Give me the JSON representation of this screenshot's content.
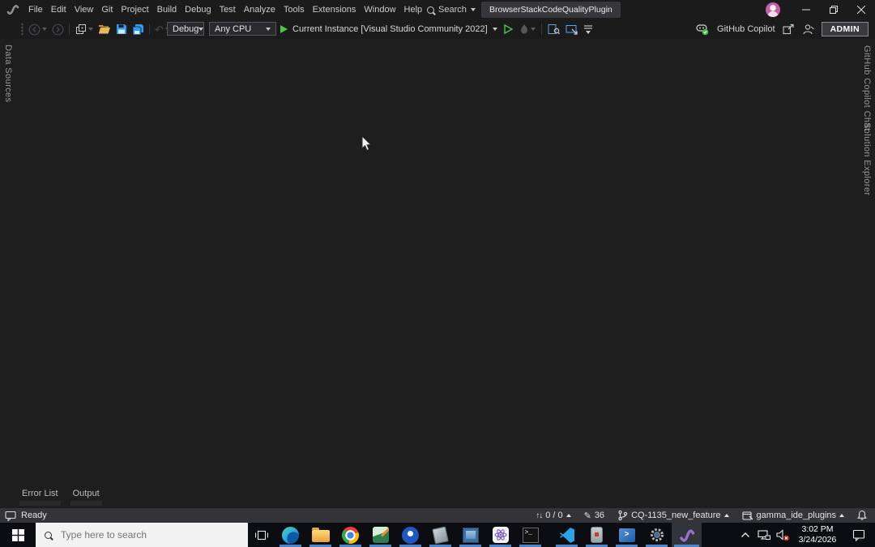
{
  "title_bar": {
    "menu_items": [
      "File",
      "Edit",
      "View",
      "Git",
      "Project",
      "Build",
      "Debug",
      "Test",
      "Analyze",
      "Tools",
      "Extensions",
      "Window",
      "Help"
    ],
    "search_label": "Search",
    "solution_name": "BrowserStackCodeQualityPlugin"
  },
  "toolbar": {
    "configuration": "Debug",
    "platform": "Any CPU",
    "run_target": "Current Instance [Visual Studio Community 2022]",
    "copilot_label": "GitHub Copilot",
    "account_label": "ADMIN"
  },
  "side_tabs": {
    "left_tab": "Data Sources",
    "right_tab_1": "GitHub Copilot Chat",
    "right_tab_2": "Solution Explorer"
  },
  "bottom_panel": {
    "tab_1": "Error List",
    "tab_2": "Output"
  },
  "status_bar": {
    "message": "Ready",
    "sync_count": "0 / 0",
    "pending_edits": "36",
    "branch_name": "CQ-1135_new_feature",
    "repo_name": "gamma_ide_plugins"
  },
  "taskbar": {
    "search_placeholder": "Type here to search",
    "clock_time": "3:02 PM",
    "clock_date": "3/24/2026"
  },
  "glyphs": {
    "undo": "↶",
    "redo": "↷",
    "sync": "↑↓",
    "pencil": "✎",
    "terminal": ">_",
    "powershell": ">"
  },
  "icon_names": [
    "vs-logo-icon",
    "search-icon",
    "minimize-icon",
    "restore-icon",
    "close-icon",
    "back-icon",
    "forward-icon",
    "new-project-icon",
    "open-folder-icon",
    "save-icon",
    "save-all-icon",
    "undo-icon",
    "redo-icon",
    "run-icon",
    "start-without-debug-icon",
    "hot-reload-icon",
    "find-in-files-icon",
    "attach-icon",
    "toolbar-overflow-icon",
    "github-copilot-icon",
    "share-icon",
    "feedback-icon",
    "feedback-bubble-icon",
    "sync-icon",
    "pencil-icon",
    "branch-icon",
    "repo-icon",
    "bell-icon",
    "windows-start-icon",
    "task-view-icon",
    "edge-icon",
    "file-explorer-icon",
    "chrome-icon",
    "image-editor-icon",
    "maps-icon",
    "notepad-icon",
    "media-player-icon",
    "atom-app-icon",
    "command-prompt-icon",
    "vscode-icon",
    "mobile-device-icon",
    "powershell-icon",
    "settings-gear-icon",
    "visual-studio-icon",
    "tray-chevron-icon",
    "network-icon",
    "volume-muted-icon",
    "action-center-icon",
    "mouse-cursor"
  ],
  "colors": {
    "titlebar_bg": "#1b1b1c",
    "canvas_bg": "#1e1e1f",
    "statusbar_bg": "#343438",
    "taskbar_bg": "#0c0d10",
    "run_green": "#4dc352",
    "save_blue": "#2d9cec",
    "folder_yellow": "#e8a33d",
    "taskbar_underline": "#4f83c2",
    "avatar_pink": "#c55fa5",
    "vs_purple": "#9b6fd0"
  }
}
